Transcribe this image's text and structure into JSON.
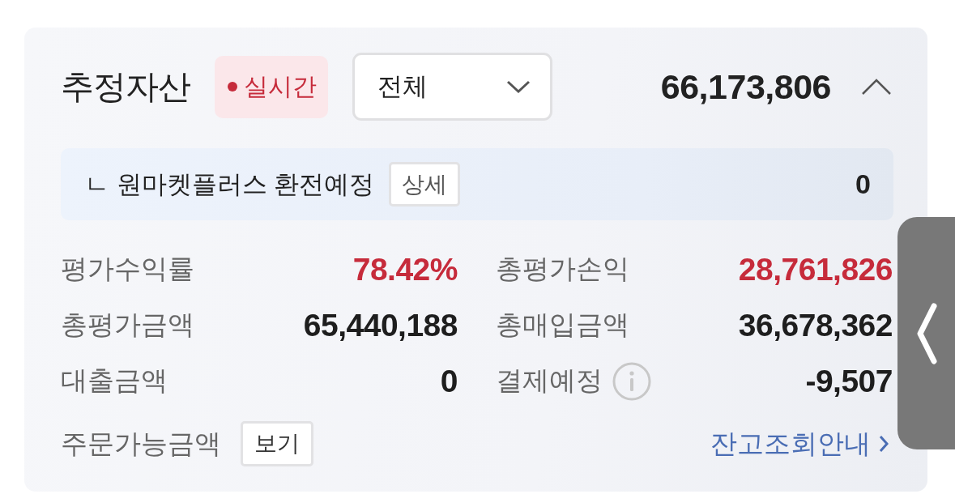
{
  "header": {
    "title": "추정자산",
    "live_badge": "실시간",
    "filter": {
      "value": "전체"
    },
    "total": "66,173,806",
    "expanded": true
  },
  "exchange_row": {
    "label": "ㄴ 원마켓플러스 환전예정",
    "detail_button": "상세",
    "value": "0"
  },
  "metrics": [
    {
      "label": "평가수익률",
      "value": "78.42%",
      "color": "#c62b3b",
      "info": false
    },
    {
      "label": "총평가손익",
      "value": "28,761,826",
      "color": "#c62b3b",
      "info": false
    },
    {
      "label": "총평가금액",
      "value": "65,440,188",
      "color": "#1e1e1e",
      "info": false
    },
    {
      "label": "총매입금액",
      "value": "36,678,362",
      "color": "#1e1e1e",
      "info": false
    },
    {
      "label": "대출금액",
      "value": "0",
      "color": "#1e1e1e",
      "info": false
    },
    {
      "label": "결제예정",
      "value": "-9,507",
      "color": "#1e1e1e",
      "info": true
    }
  ],
  "order_amount": {
    "label": "주문가능금액",
    "button": "보기"
  },
  "guide_link": "잔고조회안내"
}
